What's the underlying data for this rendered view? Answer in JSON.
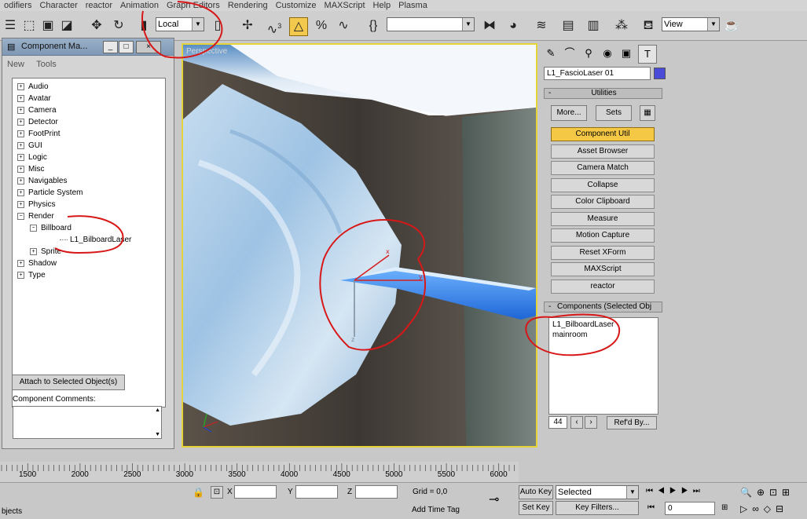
{
  "menu": [
    "odifiers",
    "Character",
    "reactor",
    "Animation",
    "Graph Editors",
    "Rendering",
    "Customize",
    "MAXScript",
    "Help",
    "Plasma"
  ],
  "toolbar": {
    "ref_coord": "Local",
    "named_selection": "",
    "view_combo": "View",
    "angle_snap_label": "3"
  },
  "component_manager": {
    "title": "Component Ma...",
    "menu": [
      "New",
      "Tools"
    ],
    "tree": [
      {
        "label": "Audio",
        "box": "+"
      },
      {
        "label": "Avatar",
        "box": "+"
      },
      {
        "label": "Camera",
        "box": "+"
      },
      {
        "label": "Detector",
        "box": "+"
      },
      {
        "label": "FootPrint",
        "box": "+"
      },
      {
        "label": "GUI",
        "box": "+"
      },
      {
        "label": "Logic",
        "box": "+"
      },
      {
        "label": "Misc",
        "box": "+"
      },
      {
        "label": "Navigables",
        "box": "+"
      },
      {
        "label": "Particle System",
        "box": "+"
      },
      {
        "label": "Physics",
        "box": "+"
      },
      {
        "label": "Render",
        "box": "−"
      },
      {
        "label": "Billboard",
        "box": "−"
      },
      {
        "label": "L1_BilboardLaser",
        "box": ""
      },
      {
        "label": "Sprite",
        "box": "+"
      },
      {
        "label": "Shadow",
        "box": "+"
      },
      {
        "label": "Type",
        "box": "+"
      }
    ],
    "attach_button": "Attach to Selected Object(s)",
    "comments_label": "Component Comments:"
  },
  "viewport": {
    "label": "Perspective"
  },
  "command_panel": {
    "object_name": "L1_FascioLaser 01",
    "object_color": "#4a4ad8",
    "utilities_header": "Utilities",
    "more_button": "More...",
    "sets_button": "Sets",
    "utilities": [
      "Component Util",
      "Asset Browser",
      "Camera Match",
      "Collapse",
      "Color Clipboard",
      "Measure",
      "Motion Capture",
      "Reset XForm",
      "MAXScript",
      "reactor"
    ],
    "selected_utility": "Component Util",
    "components_header": "Components (Selected Obj",
    "components": [
      "L1_BilboardLaser",
      "mainroom"
    ],
    "count": "44",
    "refd_by_button": "Ref'd By..."
  },
  "timeline": {
    "ticks": [
      "1500",
      "2000",
      "2500",
      "3000",
      "3500",
      "4000",
      "4500",
      "5000",
      "5500",
      "6000"
    ]
  },
  "status": {
    "left_text": "bjects",
    "x_label": "X",
    "y_label": "Y",
    "z_label": "Z",
    "grid": "Grid = 0,0",
    "add_time_tag": "Add Time Tag",
    "auto_key": "Auto Key",
    "set_key": "Set Key",
    "key_mode": "Selected",
    "key_filters": "Key Filters...",
    "frame": "0"
  },
  "colors": {
    "accent_active": "#f2c94c",
    "annotation": "#d81818",
    "viewport_border": "#e4d43a"
  }
}
